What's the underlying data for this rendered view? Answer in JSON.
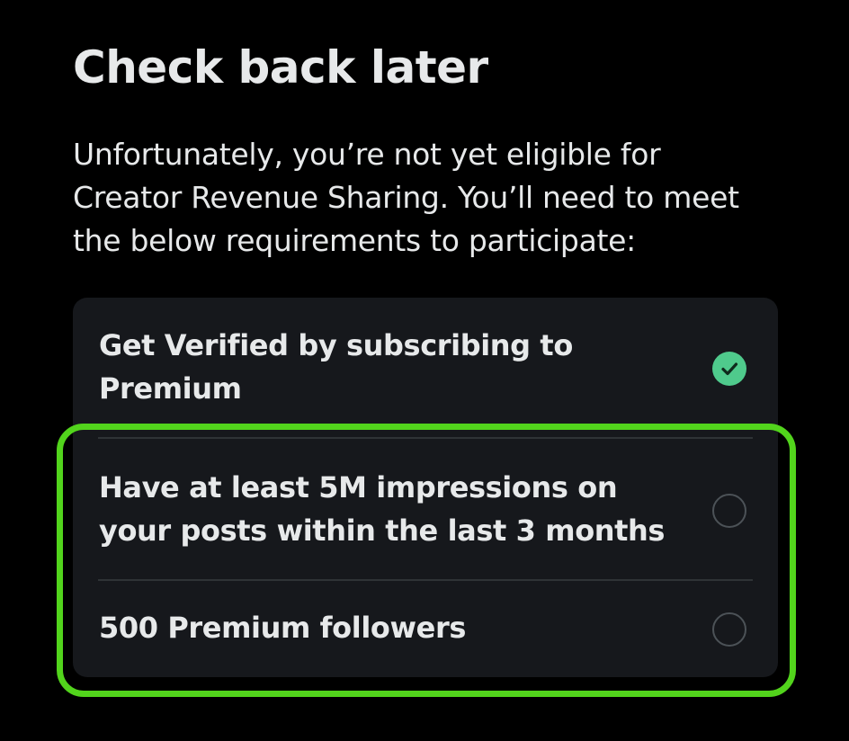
{
  "header": {
    "title": "Check back later"
  },
  "description": "Unfortunately, you’re not yet eligible for Creator Revenue Sharing. You’ll need to meet the below requirements to participate:",
  "requirements": [
    {
      "label": "Get Verified by subscribing to Premium",
      "status": "met",
      "icon": "checkmark-circle-icon"
    },
    {
      "label": "Have at least 5M impressions on your posts within the last 3 months",
      "status": "not met",
      "icon": "empty-circle-icon"
    },
    {
      "label": "500 Premium followers",
      "status": "not met",
      "icon": "empty-circle-icon"
    }
  ],
  "colors": {
    "background": "#000000",
    "card": "#16181c",
    "text": "#e7e9ea",
    "met_check": "#4fca8c",
    "pending_circle": "#4c5257",
    "highlight": "#52d41c"
  }
}
